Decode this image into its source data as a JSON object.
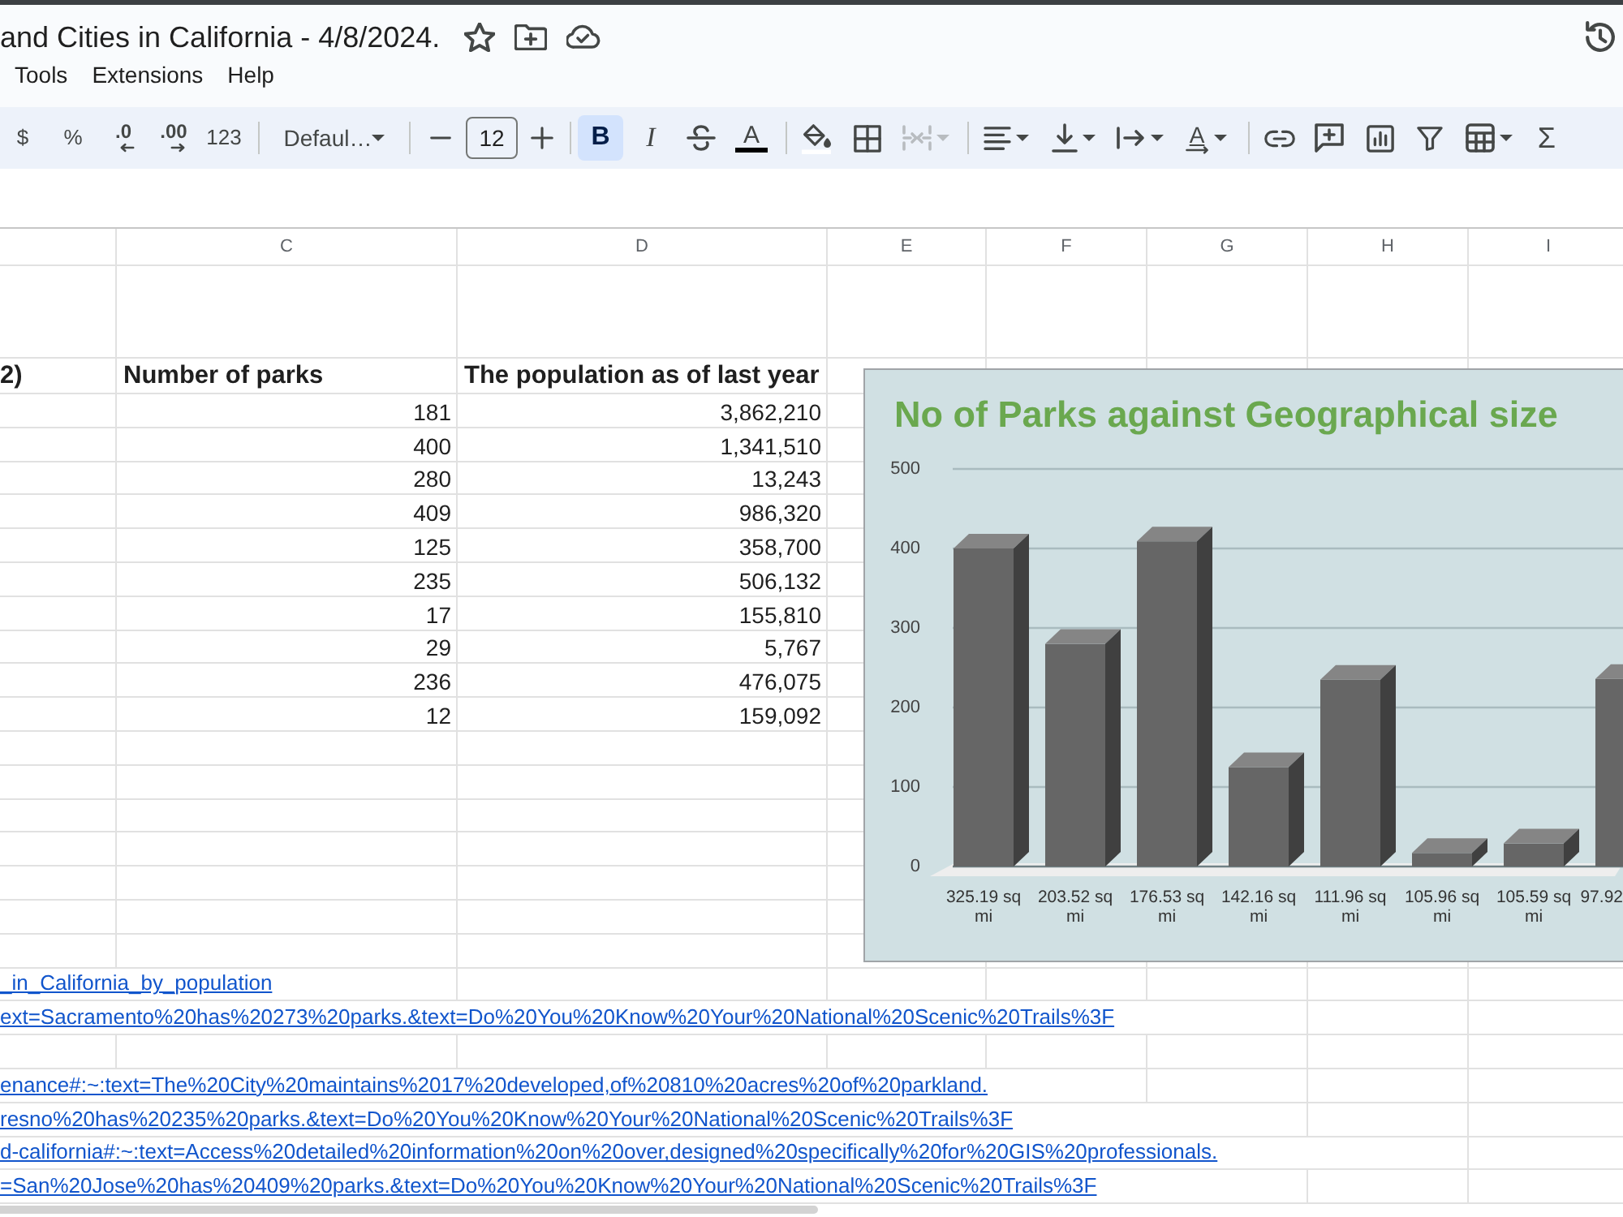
{
  "document": {
    "title": "and Cities in California - 4/8/2024."
  },
  "menu": [
    {
      "label": "Tools"
    },
    {
      "label": "Extensions"
    },
    {
      "label": "Help"
    }
  ],
  "toolbar": {
    "number_buttons": [
      {
        "kind": "plain",
        "label": "$"
      },
      {
        "kind": "plain",
        "label": "%"
      },
      {
        "kind": "decrease",
        "label": ".0"
      },
      {
        "kind": "increase",
        "label": ".00"
      },
      {
        "kind": "plain",
        "label": "123"
      }
    ],
    "font": {
      "value": "Defaul…"
    },
    "font_size": {
      "value": "12"
    },
    "text_buttons": [
      {
        "kind": "bold",
        "label": "B",
        "selected": true
      },
      {
        "kind": "italic",
        "label": "I",
        "selected": false
      },
      {
        "kind": "strike",
        "selected": false
      },
      {
        "kind": "color",
        "label": "A",
        "selected": false
      }
    ],
    "cell_buttons": [
      {
        "kind": "fill",
        "disabled": false
      },
      {
        "kind": "borders",
        "disabled": false
      },
      {
        "kind": "merge",
        "disabled": true
      }
    ],
    "align_buttons": [
      {
        "kind": "horizontal"
      },
      {
        "kind": "vertical"
      },
      {
        "kind": "wrap"
      },
      {
        "kind": "rotate",
        "label": "A"
      }
    ],
    "insert_buttons": [
      {
        "kind": "link"
      },
      {
        "kind": "comment"
      },
      {
        "kind": "chart"
      },
      {
        "kind": "filter"
      },
      {
        "kind": "table"
      },
      {
        "kind": "sum",
        "label": "Σ"
      }
    ]
  },
  "sheet": {
    "columns": [
      "C",
      "D",
      "E",
      "F",
      "G",
      "H",
      "I"
    ],
    "headings": {
      "column_b": "2)",
      "parks": "Number of parks",
      "population": "The population as of last year"
    },
    "rows": [
      {
        "parks": "181",
        "population": "3,862,210"
      },
      {
        "parks": "400",
        "population": "1,341,510"
      },
      {
        "parks": "280",
        "population": "13,243"
      },
      {
        "parks": "409",
        "population": "986,320"
      },
      {
        "parks": "125",
        "population": "358,700"
      },
      {
        "parks": "235",
        "population": "506,132"
      },
      {
        "parks": "17",
        "population": "155,810"
      },
      {
        "parks": "29",
        "population": "5,767"
      },
      {
        "parks": "236",
        "population": "476,075"
      },
      {
        "parks": "12",
        "population": "159,092"
      }
    ],
    "link_groups": [
      [
        "_in_California_by_population",
        "ext=Sacramento%20has%20273%20parks.&text=Do%20You%20Know%20Your%20National%20Scenic%20Trails%3F"
      ],
      [
        "enance#:~:text=The%20City%20maintains%2017%20developed,of%20810%20acres%20of%20parkland.",
        "resno%20has%20235%20parks.&text=Do%20You%20Know%20Your%20National%20Scenic%20Trails%3F",
        "d-california#:~:text=Access%20detailed%20information%20on%20over,designed%20specifically%20for%20GIS%20professionals.",
        "=San%20Jose%20has%20409%20parks.&text=Do%20You%20Know%20Your%20National%20Scenic%20Trails%3F"
      ]
    ]
  },
  "chart": {
    "chart_data": {
      "type": "bar",
      "title": "No of Parks against Geographical size",
      "categories": [
        "325.19 sq mi",
        "203.52 sq mi",
        "176.53 sq mi",
        "142.16 sq mi",
        "111.96 sq mi",
        "105.96 sq mi",
        "105.59 sq mi",
        "97.92"
      ],
      "values": [
        400,
        280,
        409,
        125,
        235,
        17,
        29,
        236
      ],
      "ylim": [
        0,
        500
      ],
      "yticks": [
        0,
        100,
        200,
        300,
        400,
        500
      ],
      "grid": true
    }
  }
}
